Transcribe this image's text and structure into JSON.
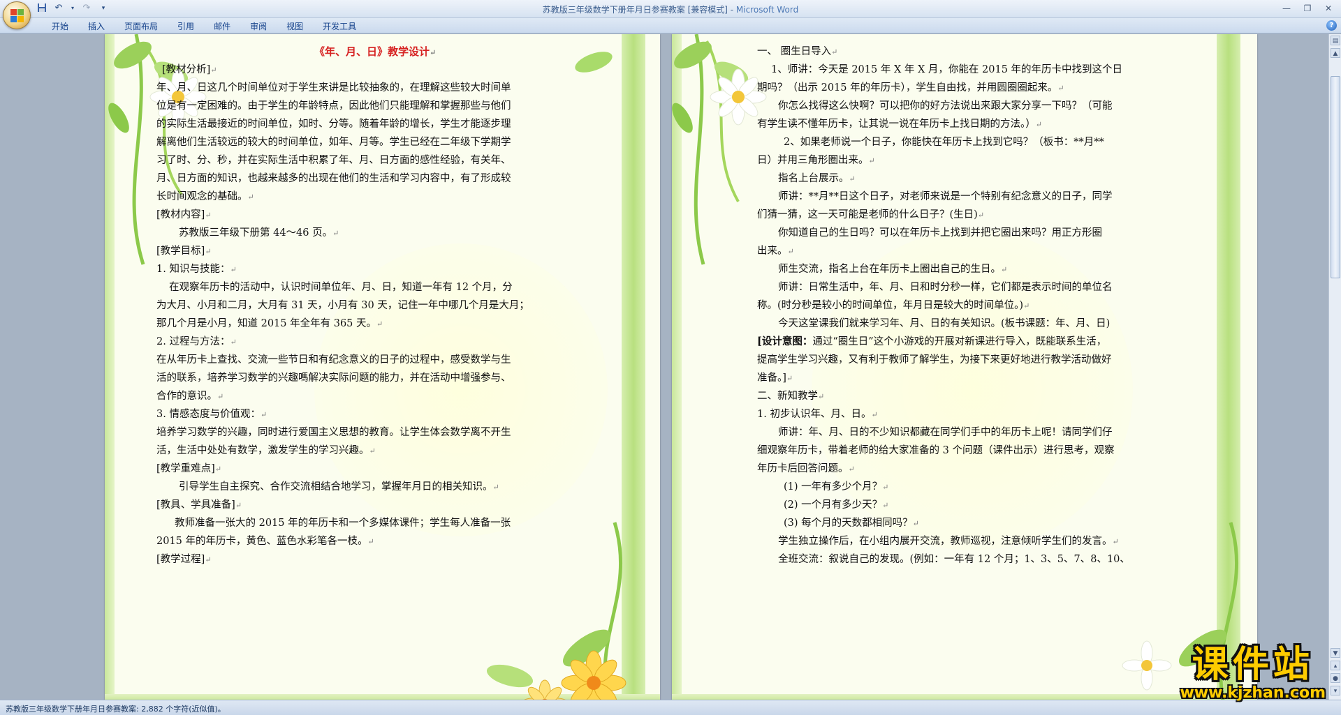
{
  "window": {
    "title": "苏教版三年级数学下册年月日参赛教案 [兼容模式] - ",
    "app_name": "Microsoft Word"
  },
  "quick_access": [
    "save-icon",
    "undo-icon",
    "redo-icon",
    "customize-icon"
  ],
  "ribbon": {
    "tabs": [
      "开始",
      "插入",
      "页面布局",
      "引用",
      "邮件",
      "审阅",
      "视图",
      "开发工具"
    ]
  },
  "left_page": {
    "title": "《年、月、日》教学设计",
    "lines": [
      "[教材分析]",
      "年、月、日这几个时间单位对于学生来讲是比较抽象的，在理解这些较大时间单",
      "位是有一定困难的。由于学生的年龄特点，因此他们只能理解和掌握那些与他们",
      "的实际生活最接近的时间单位，如时、分等。随着年龄的增长，学生才能逐步理",
      "解离他们生活较远的较大的时间单位，如年、月等。学生已经在二年级下学期学",
      "习了时、分、秒，并在实际生活中积累了年、月、日方面的感性经验，有关年、",
      "月、日方面的知识，也越来越多的出现在他们的生活和学习内容中，有了形成较",
      "长时间观念的基础。",
      "[教材内容]",
      "苏教版三年级下册第 44～46 页。",
      "[教学目标]",
      "1. 知识与技能：",
      "在观察年历卡的活动中，认识时间单位年、月、日，知道一年有 12 个月，分",
      "为大月、小月和二月，大月有 31 天，小月有 30 天，记住一年中哪几个月是大月；",
      "那几个月是小月，知道 2015 年全年有 365 天。",
      "2. 过程与方法：",
      "在从年历卡上查找、交流一些节日和有纪念意义的日子的过程中，感受数学与生",
      "活的联系，培养学习数学的兴趣嗎解决实际问题的能力，并在活动中增强参与、",
      "合作的意识。",
      "3. 情感态度与价值观：",
      "培养学习数学的兴趣，同时进行爱国主义思想的教育。让学生体会数学离不开生",
      "活，生活中处处有数学，激发学生的学习兴趣。",
      "[教学重难点]",
      "引导学生自主探究、合作交流相结合地学习，掌握年月日的相关知识。",
      "[教具、学具准备]",
      "教师准备一张大的 2015 年的年历卡和一个多媒体课件；学生每人准备一张",
      "2015 年的年历卡，黄色、蓝色水彩笔各一枝。",
      "[教学过程]"
    ]
  },
  "right_page": {
    "lines": [
      "一、   圈生日导入",
      "1、师讲：今天是 2015 年 X 年 X 月，你能在 2015 年的年历卡中找到这个日",
      "期吗？（出示 2015 年的年历卡），学生自由找，并用圆圈圈起来。",
      "你怎么找得这么快啊？可以把你的好方法说出来跟大家分享一下吗？（可能",
      "有学生读不懂年历卡，让其说一说在年历卡上找日期的方法。）",
      "2、如果老师说一个日子，你能快在年历卡上找到它吗？（板书：**月**",
      "日）并用三角形圈出来。",
      "指名上台展示。",
      "师讲：**月**日这个日子，对老师来说是一个特别有纪念意义的日子，同学",
      "们猜一猜，这一天可能是老师的什么日子？(生日)",
      "你知道自己的生日吗？可以在年历卡上找到并把它圈出来吗？用正方形圈",
      "出来。",
      "师生交流，指名上台在年历卡上圈出自己的生日。",
      "师讲：日常生活中，年、月、日和时分秒一样，它们都是表示时间的单位名",
      "称。(时分秒是较小的时间单位，年月日是较大的时间单位。)",
      "今天这堂课我们就来学习年、月、日的有关知识。(板书课题：年、月、日)",
      "[设计意图：通过“圈生日”这个小游戏的开展对新课进行导入，既能联系生活，",
      "提高学生学习兴趣，又有利于教师了解学生，为接下来更好地进行教学活动做好",
      "准备。]",
      "二、新知教学",
      "1. 初步认识年、月、日。",
      "师讲：年、月、日的不少知识都藏在同学们手中的年历卡上呢！请同学们仔",
      "细观察年历卡，带着老师的给大家准备的 3 个问题（课件出示）进行思考，观察",
      "年历卡后回答问题。",
      "(1)   一年有多少个月？",
      "(2)   一个月有多少天？",
      "(3)   每个月的天数都相同吗？",
      "学生独立操作后，在小组内展开交流，教师巡视，注意倾听学生们的发言。",
      "全班交流：叙说自己的发现。(例如：一年有 12 个月；1、3、5、7、8、10、"
    ]
  },
  "status_bar": {
    "text": "苏教版三年级数学下册年月日参赛教案: 2,882 个字符(近似值)。"
  },
  "watermark": {
    "big": "课件站",
    "url": "www.kjzhan.com"
  },
  "colors": {
    "title_red": "#d62121",
    "page_bg": "#fbfdef",
    "frame_green": "#b8e07f",
    "watermark_yellow": "#ffcc00"
  }
}
